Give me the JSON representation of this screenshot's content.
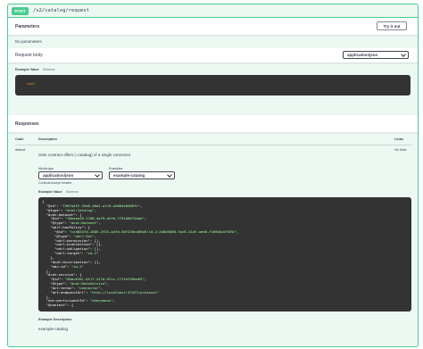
{
  "operation": {
    "method": "POST",
    "path": "/v2/catalog/request"
  },
  "parameters": {
    "title": "Parameters",
    "try_label": "Try it out",
    "no_params": "No parameters"
  },
  "request_body": {
    "label": "Request body",
    "content_type": "application/json",
    "tab_example_value": "Example Value",
    "tab_schema": "Schema",
    "example": "null"
  },
  "responses": {
    "title": "Responses",
    "col_code": "Code",
    "col_description": "Description",
    "col_links": "Links",
    "code": "default",
    "description": "Gets contract offers (=catalog) of a single connector",
    "links": "No links",
    "media_type_label": "Media type",
    "media_type_value": "application/json",
    "examples_label": "Examples",
    "examples_value": "example-catalog",
    "controls_accept": "Controls Accept header.",
    "tab_example_value": "Example Value",
    "tab_schema": "Schema",
    "example_desc_title": "Example Description",
    "example_desc_value": "example-catalog",
    "code_lines": [
      "{",
      "  \"@id\": \"7587a43f-55e6-46d1-a7c9-a2884e0468fc\",",
      "  \"@type\": \"dcat:Catalog\",",
      "  \"dcat:dataset\": {",
      "    \"@id\": \"f6eeea18-1708-4a79-a5fd-773440072abd\",",
      "    \"@type\": \"dcat:Dataset\",",
      "    \"odrl:hasPolicy\": {",
      "      \"@id\": \"ccd8247d-1685-4f33-a4fd-58f238cd89a9:id-2:248e5868-fac6-41df-aee8-f1694b44f87b\",",
      "      \"@type\": \"odrl:Set\",",
      "      \"odrl:permission\": [],",
      "      \"odrl:prohibition\": [],",
      "      \"odrl:obligation\": [],",
      "      \"odrl:target\": \"id-2\"",
      "    },",
      "    \"dcat:distribution\": [],",
      "    \"edc:id\": \"id-2\"",
      "  },",
      "  \"dcat:service\": {",
      "    \"@id\": \"00ac6f61-0f17-417d-97cc-171fef59ee65\",",
      "    \"@type\": \"dcat:DataService\",",
      "    \"dct:terms\": \"connector\",",
      "    \"dct:endpointUrl\": \"http://localhost:47427/protocol\"",
      "  },",
      "  \"edc:participantId\": \"anonymous\",",
      "  \"@context\": {"
    ]
  },
  "colors": {
    "post_green": "#49cc90",
    "block_bg": "#edf8f3",
    "code_bg": "#333333",
    "string_green": "#a2fca2"
  }
}
